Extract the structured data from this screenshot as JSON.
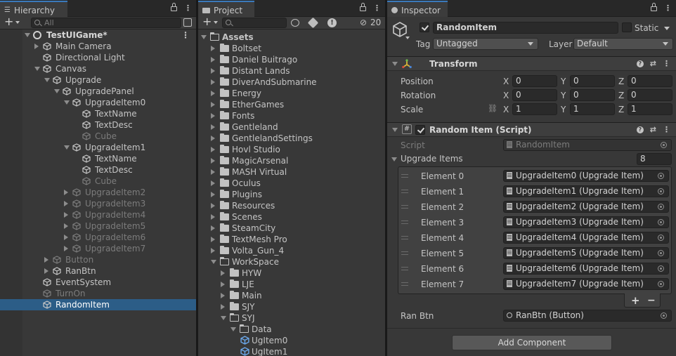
{
  "hierarchy": {
    "tab_label": "Hierarchy",
    "search_placeholder": "All",
    "add_label": "+",
    "scene": "TestUIGame*",
    "items": [
      {
        "label": "Main Camera",
        "depth": 1,
        "arrow": "right",
        "dim": false
      },
      {
        "label": "Directional Light",
        "depth": 1,
        "arrow": "none",
        "dim": false
      },
      {
        "label": "Canvas",
        "depth": 1,
        "arrow": "down",
        "dim": false
      },
      {
        "label": "Upgrade",
        "depth": 2,
        "arrow": "down",
        "dim": false
      },
      {
        "label": "UpgradePanel",
        "depth": 3,
        "arrow": "down",
        "dim": false
      },
      {
        "label": "UpgradeItem0",
        "depth": 4,
        "arrow": "down",
        "dim": false
      },
      {
        "label": "TextName",
        "depth": 5,
        "arrow": "none",
        "dim": false
      },
      {
        "label": "TextDesc",
        "depth": 5,
        "arrow": "none",
        "dim": false
      },
      {
        "label": "Cube",
        "depth": 5,
        "arrow": "none",
        "dim": true
      },
      {
        "label": "UpgradeItem1",
        "depth": 4,
        "arrow": "down",
        "dim": false
      },
      {
        "label": "TextName",
        "depth": 5,
        "arrow": "none",
        "dim": false
      },
      {
        "label": "TextDesc",
        "depth": 5,
        "arrow": "none",
        "dim": false
      },
      {
        "label": "Cube",
        "depth": 5,
        "arrow": "none",
        "dim": true
      },
      {
        "label": "UpgradeItem2",
        "depth": 4,
        "arrow": "right",
        "dim": true
      },
      {
        "label": "UpgradeItem3",
        "depth": 4,
        "arrow": "right",
        "dim": true
      },
      {
        "label": "UpgradeItem4",
        "depth": 4,
        "arrow": "right",
        "dim": true
      },
      {
        "label": "UpgradeItem5",
        "depth": 4,
        "arrow": "right",
        "dim": true
      },
      {
        "label": "UpgradeItem6",
        "depth": 4,
        "arrow": "right",
        "dim": true
      },
      {
        "label": "UpgradeItem7",
        "depth": 4,
        "arrow": "right",
        "dim": true
      },
      {
        "label": "Button",
        "depth": 2,
        "arrow": "right",
        "dim": true
      },
      {
        "label": "RanBtn",
        "depth": 2,
        "arrow": "right",
        "dim": false
      },
      {
        "label": "EventSystem",
        "depth": 1,
        "arrow": "none",
        "dim": false
      },
      {
        "label": "TurnOn",
        "depth": 1,
        "arrow": "none",
        "dim": true
      },
      {
        "label": "RandomItem",
        "depth": 1,
        "arrow": "none",
        "dim": false,
        "selected": true
      }
    ]
  },
  "project": {
    "tab_label": "Project",
    "add_label": "+",
    "hidden_count": "20",
    "items": [
      {
        "label": "Assets",
        "depth": 0,
        "arrow": "down",
        "bold": true,
        "open": true
      },
      {
        "label": "Boltset",
        "depth": 1,
        "arrow": "right"
      },
      {
        "label": "Daniel Buitrago",
        "depth": 1,
        "arrow": "right"
      },
      {
        "label": "Distant Lands",
        "depth": 1,
        "arrow": "right"
      },
      {
        "label": "DiverAndSubmarine",
        "depth": 1,
        "arrow": "right"
      },
      {
        "label": "Energy",
        "depth": 1,
        "arrow": "right"
      },
      {
        "label": "EtherGames",
        "depth": 1,
        "arrow": "right"
      },
      {
        "label": "Fonts",
        "depth": 1,
        "arrow": "right"
      },
      {
        "label": "Gentleland",
        "depth": 1,
        "arrow": "right"
      },
      {
        "label": "GentlelandSettings",
        "depth": 1,
        "arrow": "right"
      },
      {
        "label": "Hovl Studio",
        "depth": 1,
        "arrow": "right"
      },
      {
        "label": "MagicArsenal",
        "depth": 1,
        "arrow": "right"
      },
      {
        "label": "MASH Virtual",
        "depth": 1,
        "arrow": "right"
      },
      {
        "label": "Oculus",
        "depth": 1,
        "arrow": "right"
      },
      {
        "label": "Plugins",
        "depth": 1,
        "arrow": "right"
      },
      {
        "label": "Resources",
        "depth": 1,
        "arrow": "right"
      },
      {
        "label": "Scenes",
        "depth": 1,
        "arrow": "right"
      },
      {
        "label": "SteamCity",
        "depth": 1,
        "arrow": "right"
      },
      {
        "label": "TextMesh Pro",
        "depth": 1,
        "arrow": "right"
      },
      {
        "label": "Volta_Gun_4",
        "depth": 1,
        "arrow": "right"
      },
      {
        "label": "WorkSpace",
        "depth": 1,
        "arrow": "down",
        "open": true
      },
      {
        "label": "HYW",
        "depth": 2,
        "arrow": "right"
      },
      {
        "label": "LJE",
        "depth": 2,
        "arrow": "right"
      },
      {
        "label": "Main",
        "depth": 2,
        "arrow": "right"
      },
      {
        "label": "SJY",
        "depth": 2,
        "arrow": "right"
      },
      {
        "label": "SYJ",
        "depth": 2,
        "arrow": "down",
        "open": true
      },
      {
        "label": "Data",
        "depth": 3,
        "arrow": "down",
        "open": true
      },
      {
        "label": "UgItem0",
        "depth": 4,
        "arrow": "none",
        "prefab": true
      },
      {
        "label": "UgItem1",
        "depth": 4,
        "arrow": "none",
        "prefab": true
      }
    ]
  },
  "inspector": {
    "tab_label": "Inspector",
    "object_name": "RandomItem",
    "static_label": "Static",
    "tag_label": "Tag",
    "tag_value": "Untagged",
    "layer_label": "Layer",
    "layer_value": "Default",
    "transform": {
      "title": "Transform",
      "rows": [
        {
          "label": "Position",
          "x": "0",
          "y": "0",
          "z": "0"
        },
        {
          "label": "Rotation",
          "x": "0",
          "y": "0",
          "z": "0"
        },
        {
          "label": "Scale",
          "x": "1",
          "y": "1",
          "z": "1"
        }
      ],
      "axis_x": "X",
      "axis_y": "Y",
      "axis_z": "Z"
    },
    "script_component": {
      "title": "Random Item (Script)",
      "script_label": "Script",
      "script_value": "RandomItem",
      "list_label": "Upgrade Items",
      "list_count": "8",
      "elements": [
        {
          "label": "Element 0",
          "value": "UpgradeItem0 (Upgrade Item)"
        },
        {
          "label": "Element 1",
          "value": "UpgradeItem1 (Upgrade Item)"
        },
        {
          "label": "Element 2",
          "value": "UpgradeItem2 (Upgrade Item)"
        },
        {
          "label": "Element 3",
          "value": "UpgradeItem3 (Upgrade Item)"
        },
        {
          "label": "Element 4",
          "value": "UpgradeItem4 (Upgrade Item)"
        },
        {
          "label": "Element 5",
          "value": "UpgradeItem5 (Upgrade Item)"
        },
        {
          "label": "Element 6",
          "value": "UpgradeItem6 (Upgrade Item)"
        },
        {
          "label": "Element 7",
          "value": "UpgradeItem7 (Upgrade Item)"
        }
      ],
      "add_label": "+",
      "remove_label": "−",
      "ranbtn_label": "Ran Btn",
      "ranbtn_value": "RanBtn (Button)"
    },
    "add_component_label": "Add Component"
  },
  "colors": {
    "selection": "#2c5d87",
    "tab_accent": "#3a79bb",
    "panel": "#383838"
  },
  "icons": [
    "lock-icon",
    "kebab-menu-icon",
    "search-icon",
    "cube-icon",
    "folder-icon",
    "prefab-icon",
    "gameobject-icon",
    "transform-icon",
    "script-icon",
    "help-icon",
    "preset-icon",
    "object-picker-icon"
  ]
}
